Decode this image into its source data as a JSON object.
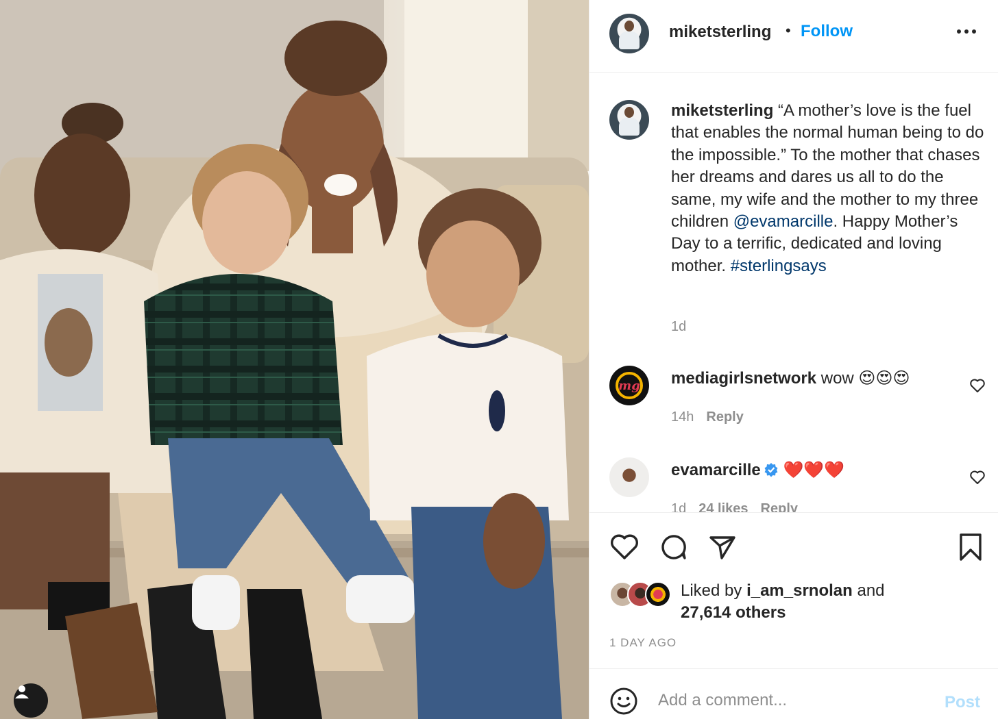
{
  "post": {
    "author": "miketsterling",
    "separator": "•",
    "follow_label": "Follow",
    "more_icon": "more-options-icon"
  },
  "caption": {
    "author": "miketsterling",
    "text_part1": " “A mother’s love is the fuel that enables the normal human being to do the impossible.” To the mother that chases her dreams and dares us all to do the same, my wife and the mother to my three children ",
    "mention": "@evamarcille",
    "text_part2": ". Happy Mother’s Day to a terrific, dedicated and loving mother. ",
    "hashtag": "#sterlingsays",
    "time": "1d"
  },
  "comments": [
    {
      "author": "mediagirlsnetwork",
      "avatar_text": "mg",
      "text": "wow",
      "emoji": "😍😍😍",
      "time": "14h",
      "reply_label": "Reply"
    },
    {
      "author": "evamarcille",
      "verified": true,
      "text": "",
      "emoji": "❤️❤️❤️",
      "time": "1d",
      "likes": "24 likes",
      "reply_label": "Reply"
    }
  ],
  "likes": {
    "prefix": "Liked by ",
    "first_liker": "i_am_srnolan",
    "middle": " and",
    "others": "27,614 others"
  },
  "posted_ago": "1 DAY AGO",
  "composer": {
    "placeholder": "Add a comment...",
    "post_label": "Post"
  },
  "colors": {
    "accent": "#0095f6",
    "link": "#00376b",
    "muted": "#8e8e8e",
    "post_disabled": "#b2dffc"
  }
}
